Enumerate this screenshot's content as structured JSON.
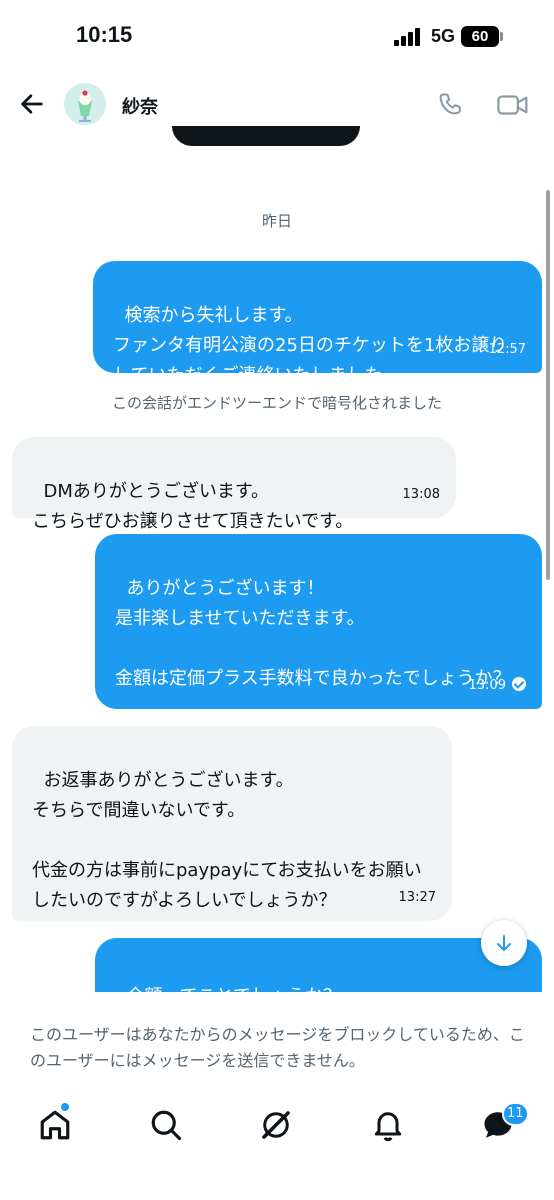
{
  "status_bar": {
    "time": "10:15",
    "network": "5G",
    "battery": "60"
  },
  "header": {
    "contact_name": "紗奈"
  },
  "conversation": {
    "date_divider": "昨日",
    "encryption_notice": "この会話がエンドツーエンドで暗号化されました",
    "messages": [
      {
        "side": "sent",
        "text": "検索から失礼します。\nファンタ有明公演の25日のチケットを1枚お譲りしていただくご連絡いたしました。",
        "time": "12:57"
      },
      {
        "side": "received",
        "text": "DMありがとうございます。\nこちらぜひお譲りさせて頂きたいです。",
        "time": "13:08"
      },
      {
        "side": "sent",
        "text": "ありがとうございます！\n是非楽しませていただきます。\n\n金額は定価プラス手数料で良かったでしょうか？",
        "time": "13:09",
        "read": true
      },
      {
        "side": "received",
        "text": "お返事ありがとうございます。\nそちらで間違いないです。\n\n代金の方は事前にpaypayにてお支払いをお願いしたいのですがよろしいでしょうか？",
        "time": "13:27"
      },
      {
        "side": "sent",
        "text": "全額ってことでしょうか？",
        "time": ""
      }
    ]
  },
  "blocked_notice": "このユーザーはあなたからのメッセージをブロックしているため、このユーザーにはメッセージを送信できません。",
  "tabbar": {
    "messages_badge": "11"
  },
  "colors": {
    "accent": "#1d9bf0",
    "received_bubble": "#eff3f4",
    "muted_text": "#536471"
  }
}
